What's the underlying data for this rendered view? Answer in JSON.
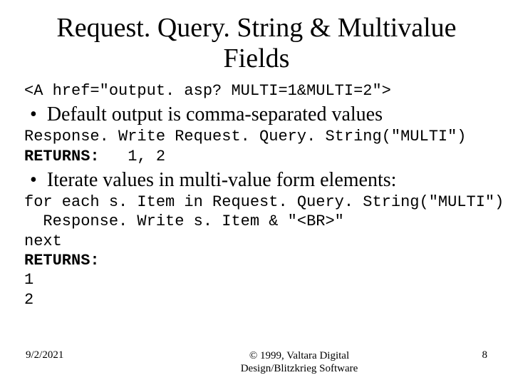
{
  "title_line1": "Request. Query. String & Multivalue",
  "title_line2": "Fields",
  "code_href": "<A href=\"output. asp? MULTI=1&MULTI=2\">",
  "bullet1": "Default output is comma-separated values",
  "code_resp1": "Response. Write Request. Query. String(\"MULTI\")",
  "returns1_label": "RETURNS:",
  "returns1_val": "   1, 2",
  "bullet2": "Iterate values in multi-value form elements:",
  "code_loop1": "for each s. Item in Request. Query. String(\"MULTI\")",
  "code_loop2": "  Response. Write s. Item & \"<BR>\"",
  "code_loop3": "next",
  "returns2_label": "RETURNS:",
  "returns2_l1": "1",
  "returns2_l2": "2",
  "footer": {
    "date": "9/2/2021",
    "copyright_l1": "© 1999, Valtara Digital",
    "copyright_l2": "Design/Blitzkrieg Software",
    "page": "8"
  }
}
